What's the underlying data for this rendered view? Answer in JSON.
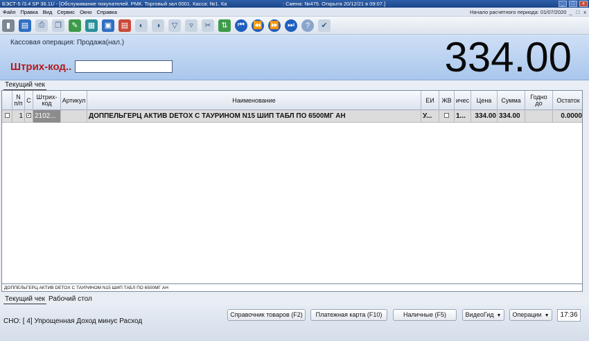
{
  "titlebar": {
    "left": "БЭСТ-5 /3.4 SP 36.11/ - [Обслуживание покупателей. РМК. Торговый зал 0001. Касса: №1. Ка",
    "right": ": Смена: №475. Открыта 20/12/21 в 09:07.]"
  },
  "menu": {
    "items": [
      "Файл",
      "Правка",
      "Вид",
      "Сервис",
      "Окно",
      "Справка"
    ],
    "period_label": "Начало расчетного периода: 01/07/2020",
    "controls": [
      "_",
      "□",
      "x"
    ]
  },
  "operation": {
    "type_label": "Кассовая операция: Продажа(нал.)",
    "barcode_label": "Штрих-код..",
    "barcode_value": "",
    "total": "334.00"
  },
  "tabs_top": [
    "Текущий чек"
  ],
  "grid": {
    "columns": [
      "N п/п",
      "С",
      "Штрих-код",
      "Артикул",
      "Наименование",
      "ЕИ",
      "ЖВ",
      "Кол-ичес",
      "Цена",
      "Сумма",
      "Годно до",
      "Остаток"
    ],
    "columns_shown": [
      "N\nп/п",
      "С",
      "Штрих-код",
      "Артикул",
      "Наименование",
      "ЕИ",
      "ЖВ",
      "ичес",
      "Цена",
      "Сумма",
      "Годно\nдо",
      "Остаток"
    ],
    "rows": [
      {
        "num": "1",
        "checked": "✓",
        "barcode": "2102...",
        "article": "",
        "name": "ДОППЕЛЬГЕРЦ АКТИВ DETOX С ТАУРИНОМ N15 ШИП ТАБЛ ПО 6500МГ АН",
        "unit": "У...",
        "zhv": "",
        "qty": "1...",
        "price": "334.00",
        "sum": "334.00",
        "expiry": "",
        "stock": "0.0000"
      }
    ]
  },
  "description_line": "ДОППЕЛЬГЕРЦ АКТИВ DETOX С ТАУРИНОМ N15 ШИП ТАБЛ ПО 6500МГ АН",
  "tabs_bottom": [
    "Текущий чек",
    "Рабочий стол"
  ],
  "bottom": {
    "tax_label": "СНО: [ 4] Упрощенная Доход минус Расход",
    "buttons": {
      "catalog": "Справочник товаров (F2)",
      "card": "Платежная карта (F10)",
      "cash": "Наличные (F5)",
      "video": "ВидеоГид",
      "operations": "Операции"
    },
    "clock": "17:36"
  }
}
